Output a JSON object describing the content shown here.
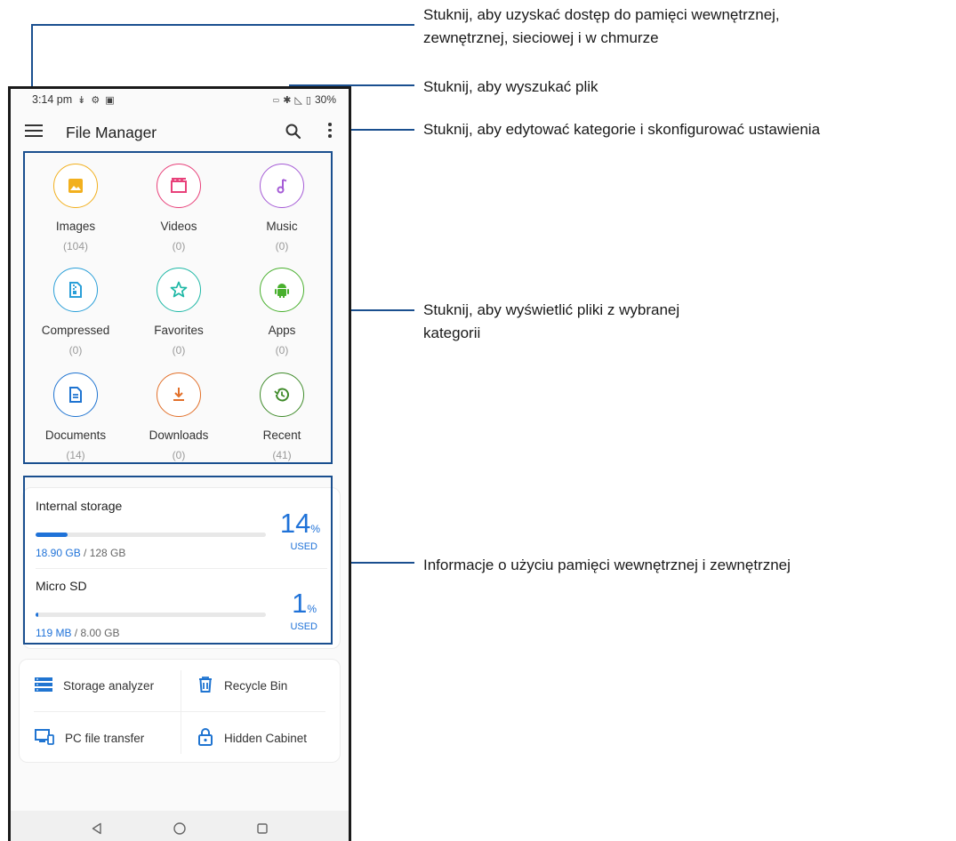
{
  "status_bar": {
    "time": "3:14 pm",
    "battery": "30%"
  },
  "app_bar": {
    "title": "File Manager"
  },
  "categories": [
    {
      "label": "Images",
      "count": "(104)",
      "icon": "image-icon",
      "color": "#f2b01e"
    },
    {
      "label": "Videos",
      "count": "(0)",
      "icon": "video-icon",
      "color": "#e8417a"
    },
    {
      "label": "Music",
      "count": "(0)",
      "icon": "music-icon",
      "color": "#a55bd6"
    },
    {
      "label": "Compressed",
      "count": "(0)",
      "icon": "archive-icon",
      "color": "#2a9fd8"
    },
    {
      "label": "Favorites",
      "count": "(0)",
      "icon": "star-icon",
      "color": "#1fb8a6"
    },
    {
      "label": "Apps",
      "count": "(0)",
      "icon": "android-icon",
      "color": "#49b02e"
    },
    {
      "label": "Documents",
      "count": "(14)",
      "icon": "document-icon",
      "color": "#1f74d1"
    },
    {
      "label": "Downloads",
      "count": "(0)",
      "icon": "download-icon",
      "color": "#e2702a"
    },
    {
      "label": "Recent",
      "count": "(41)",
      "icon": "history-icon",
      "color": "#3f8b2a"
    }
  ],
  "storage": [
    {
      "name": "Internal storage",
      "used": "18.90 GB",
      "total": " / 128 GB",
      "percent": "14",
      "percent_symbol": "%",
      "used_label": "USED",
      "fill_fraction": 0.14
    },
    {
      "name": "Micro SD",
      "used": "119 MB",
      "total": " / 8.00 GB",
      "percent": "1",
      "percent_symbol": "%",
      "used_label": "USED",
      "fill_fraction": 0.01
    }
  ],
  "tools": {
    "storage_analyzer": "Storage analyzer",
    "recycle_bin": "Recycle Bin",
    "pc_file_transfer": "PC file transfer",
    "hidden_cabinet": "Hidden Cabinet"
  },
  "annotations": {
    "menu_line1": "Stuknij, aby uzyskać dostęp do pamięci wewnętrznej,",
    "menu_line2": "zewnętrznej, sieciowej i w chmurze",
    "search": "Stuknij, aby wyszukać plik",
    "more": "Stuknij, aby edytować kategorie i skonfigurować ustawienia",
    "categories_line1": "Stuknij, aby wyświetlić pliki z wybranej",
    "categories_line2": "kategorii",
    "storage": "Informacje o użyciu pamięci wewnętrznej i zewnętrznej"
  },
  "colors": {
    "accent": "#1f72d8",
    "callout": "#1a4f8f"
  }
}
